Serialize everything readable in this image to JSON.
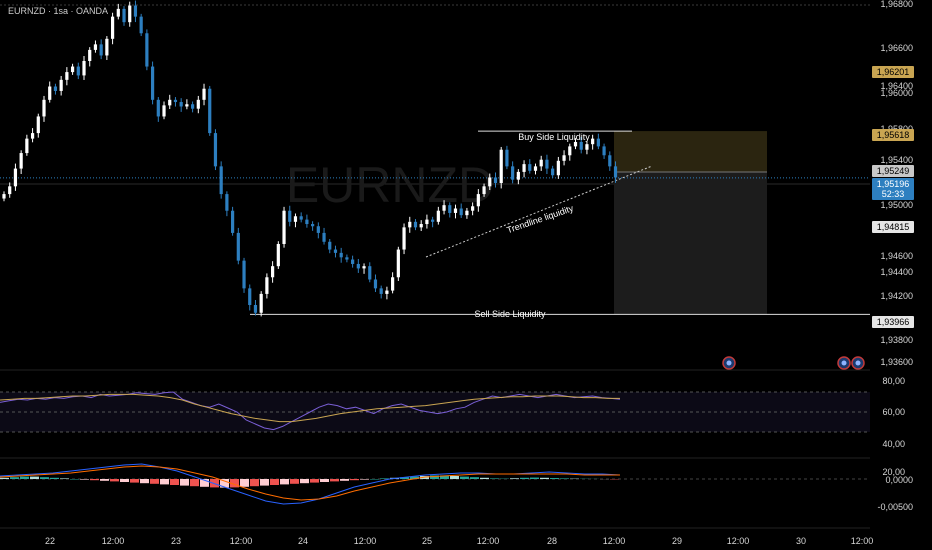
{
  "header": {
    "symbol_label": "EURNZD · 1sa · OANDA"
  },
  "watermark": "EURNZD",
  "chart_data": [
    {
      "type": "candlestick",
      "symbol": "EURNZD",
      "ylim": [
        1.935,
        1.968
      ],
      "price_ticks": [
        "1,96800",
        "1,96600",
        "1,96400",
        "1,96000",
        "1,95800",
        "1,95400",
        "1,95000",
        "1,94600",
        "1,94400",
        "1,94200",
        "1,93800",
        "1,93600"
      ],
      "time_ticks": [
        "22",
        "12:00",
        "23",
        "12:00",
        "24",
        "12:00",
        "25",
        "12:00",
        "28",
        "12:00",
        "29",
        "12:00",
        "30",
        "12:00"
      ],
      "price_badges": [
        {
          "text": "1,96201",
          "kind": "level-gold",
          "value": 1.96201
        },
        {
          "text": "1,95618",
          "kind": "level-gold",
          "value": 1.95618
        },
        {
          "text": "1,95249",
          "kind": "level-grey",
          "value": 1.95249
        },
        {
          "text": "1,95196",
          "kind": "last-price",
          "value": 1.95196
        },
        {
          "text": "52:33",
          "kind": "countdown",
          "value": 1.95125
        },
        {
          "text": "1,94815",
          "kind": "level-white",
          "value": 1.94815
        },
        {
          "text": "1,93966",
          "kind": "level-white",
          "value": 1.93966
        }
      ],
      "annotations": [
        {
          "text": "Buy Side Liquidity",
          "price": 1.9563
        },
        {
          "text": "Trendline liquidity",
          "price": 1.9488
        },
        {
          "text": "Sell Side Liquidity",
          "price": 1.9396
        }
      ],
      "levels": {
        "buy_side": 1.95618,
        "sell_side": 1.93966,
        "entry": 1.95249,
        "last": 1.95196
      },
      "trade_box": {
        "stop": 1.95618,
        "entry": 1.95249,
        "target": 1.93966
      },
      "colors": {
        "up": "#ffffff",
        "down": "#2d7fc0",
        "box_loss": "#2b2510",
        "box_target": "#1c1c1c",
        "badge_gold": "#c9a552",
        "badge_last": "#2d7fc0",
        "event_marker": "#c03a3a"
      }
    },
    {
      "type": "line",
      "name": "oscillator",
      "ylim": [
        0,
        100
      ],
      "y_ticks": [
        "80,00",
        "60,00",
        "40,00",
        "20,00"
      ],
      "bands": [
        75,
        50,
        25
      ],
      "colors": {
        "main": "#7a5fd6",
        "signal": "#c9a552"
      }
    },
    {
      "type": "histogram",
      "name": "macd",
      "y_ticks": [
        "0,0000",
        "-0,00500"
      ],
      "colors": {
        "up": "#26a69a",
        "down": "#ef5350",
        "up_weak": "#b2dfdb",
        "down_weak": "#ffcdd2",
        "macd": "#2962ff",
        "signal": "#ff6d00"
      }
    }
  ]
}
